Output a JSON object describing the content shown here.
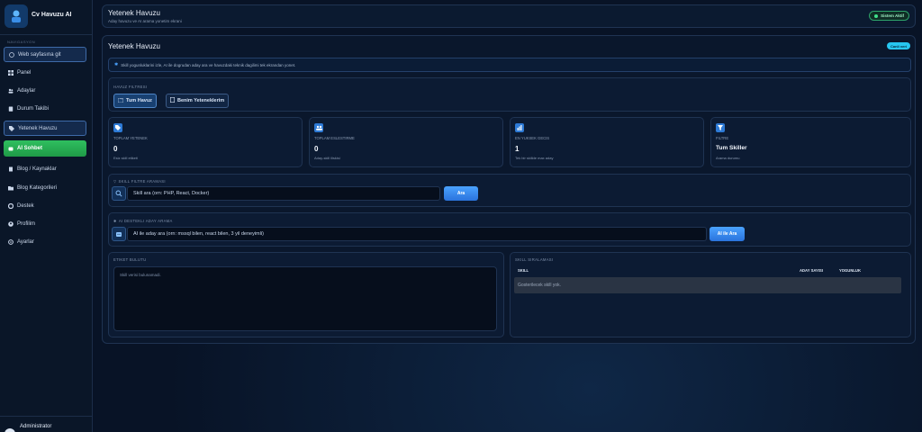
{
  "app": {
    "title": "Cv Havuzu AI"
  },
  "sidebar": {
    "section": "NAVIGASYON",
    "items": [
      {
        "label": "Web sayfasına git",
        "icon": "globe-icon"
      },
      {
        "label": "Panel",
        "icon": "grid-icon"
      },
      {
        "label": "Adaylar",
        "icon": "users-icon"
      },
      {
        "label": "Durum Takibi",
        "icon": "clipboard-icon"
      },
      {
        "label": "Yetenek Havuzu",
        "icon": "tag-icon"
      },
      {
        "label": "AI Sohbet",
        "icon": "robot-icon"
      },
      {
        "label": "Blog / Kaynaklar",
        "icon": "document-icon"
      },
      {
        "label": "Blog Kategorileri",
        "icon": "folder-icon"
      },
      {
        "label": "Destek",
        "icon": "lifebuoy-icon"
      },
      {
        "label": "Profilim",
        "icon": "user-circle-icon"
      },
      {
        "label": "Ayarlar",
        "icon": "gear-icon"
      }
    ],
    "user": "Administrator"
  },
  "header": {
    "title": "Yetenek Havuzu",
    "subtitle": "Aday havuzu ve AI arama yonetim ekrani",
    "status": "Sistem Aktif"
  },
  "page": {
    "title": "Yetenek Havuzu",
    "badge": "Canli veri",
    "info": "Skill yogunluklarini izle, AI ile dogrudan aday ara ve havuzdaki teknik dagilimi tek ekrandan yonet."
  },
  "filters": {
    "label": "HAVUZ FILTRESI",
    "tab_all": "Tum Havuz",
    "tab_mine": "Benim Yeteneklerim"
  },
  "stats": [
    {
      "label": "TOPLAM YETENEK",
      "value": "0",
      "sub": "Esiz skill etiketi",
      "icon": "tag-icon"
    },
    {
      "label": "TOPLAM ESLESTIRME",
      "value": "0",
      "sub": "Aday-skill iliskisi",
      "icon": "people-icon"
    },
    {
      "label": "EN YUKSEK GECIS",
      "value": "1",
      "sub": "Tek bir skillde max aday",
      "icon": "bar-chart-icon"
    },
    {
      "label": "FILTRE",
      "value": "Tum Skiller",
      "sub": "Arama durumu",
      "icon": "filter-icon"
    }
  ],
  "skill_search": {
    "label": "SKILL FILTRE ARAMASI",
    "placeholder": "Skill ara (orn: PHP, React, Docker)",
    "button": "Ara"
  },
  "ai_search": {
    "label": "AI DESTEKLI ADAY ARAMA",
    "placeholder": "AI ile aday ara (orn: mssql bilen, react bilen, 3 yil deneyimli)",
    "button": "AI ile Ara"
  },
  "cloud": {
    "label": "ETIKET BULUTU",
    "empty": "Skill verisi bulunamadi."
  },
  "ranking": {
    "label": "SKILL SIRALAMASI",
    "columns": [
      "SKILL",
      "ADAY SAYISI",
      "YOGUNLUK"
    ],
    "empty": "Gosterilecek skill yok."
  },
  "colors": {
    "accent": "#2a73dc",
    "ai_green": "#2fbf5f",
    "live": "#27c6f0"
  }
}
